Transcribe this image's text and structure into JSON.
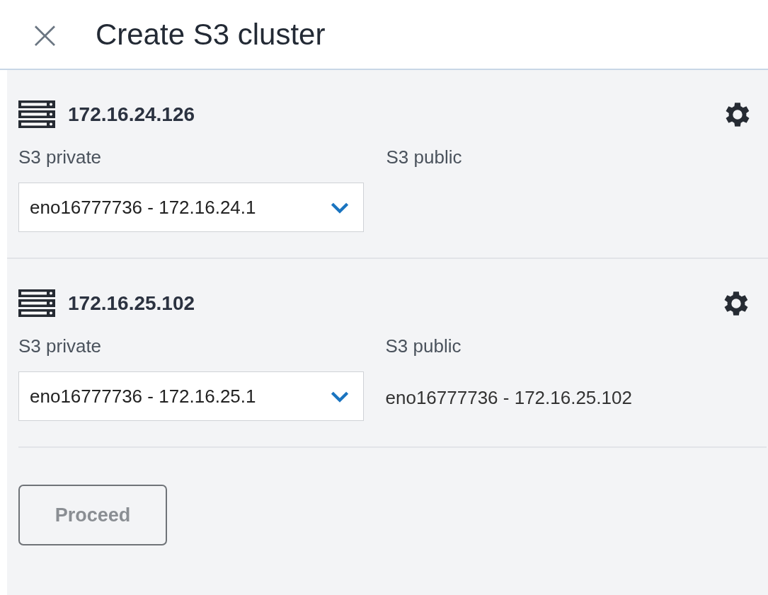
{
  "header": {
    "close": "×",
    "title": "Create S3 cluster"
  },
  "nodes": [
    {
      "address": "172.16.24.126",
      "private_label": "S3 private",
      "private_value": "eno16777736 - 172.16.24.1",
      "public_label": "S3 public"
    },
    {
      "address": "172.16.25.102",
      "private_label": "S3 private",
      "private_value": "eno16777736 - 172.16.25.1",
      "public_label": "S3 public",
      "public_value": "eno16777736 - 172.16.25.102"
    }
  ],
  "proceed_button": {
    "label": "Proceed",
    "disabled": true
  }
}
